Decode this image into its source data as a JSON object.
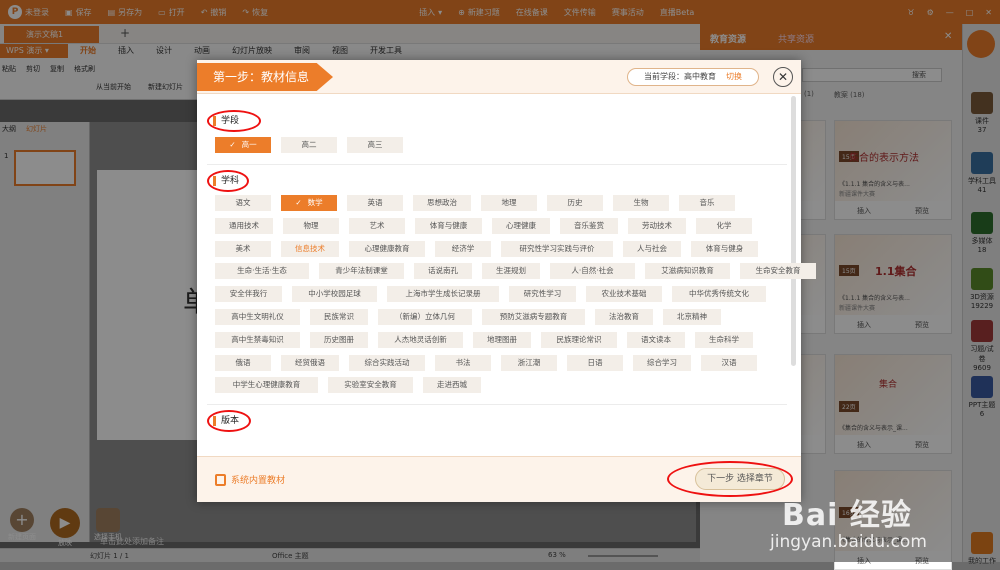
{
  "topbar": {
    "login": "未登录",
    "save": "保存",
    "save_as": "另存为",
    "open": "打开",
    "undo": "撤销",
    "redo": "恢复",
    "insert": "插入",
    "new_exercise": "新建习题",
    "online_class": "在线备课",
    "file_transfer": "文件传输",
    "contest": "赛事活动",
    "live": "直播Beta",
    "badge": "NEW"
  },
  "app": {
    "doc_tab": "演示文稿1",
    "product": "WPS 演示",
    "ribbon_tabs": [
      "开始",
      "插入",
      "设计",
      "动画",
      "幻灯片放映",
      "审阅",
      "视图",
      "开发工具"
    ],
    "ribbon_left": [
      "粘贴",
      "剪切",
      "复制",
      "格式刷"
    ],
    "from_current": "从当前开始",
    "new_slide": "新建幻灯片",
    "pane_tabs": [
      "大纲",
      "幻灯片"
    ],
    "slide_number": "1",
    "bottom_buttons": [
      "新建页面",
      "放映",
      "选择手机"
    ],
    "note_hint": "单击此处添加备注",
    "status_slide": "幻灯片 1 / 1",
    "status_theme": "Office 主题",
    "zoom": "63 %",
    "slide_char": "单"
  },
  "rightpanel": {
    "tabs": [
      "教育资源",
      "共享资源"
    ],
    "search_btn": "搜索",
    "counts": [
      "(1)",
      "教案 (18)"
    ],
    "thumbs": [
      {
        "badge": "15页",
        "title": "集合的表示方法",
        "line1": "《1.1.1 集合的含义与表...",
        "line2": "新疆课件大赛",
        "insert": "插入",
        "preview": "预览"
      },
      {
        "badge": "15页",
        "title": "1.1集合",
        "line1": "《1.1.1 集合的含义与表...",
        "line2": "新疆课件大赛",
        "insert": "插入",
        "preview": "预览"
      },
      {
        "badge": "22页",
        "title": "集合",
        "line1": "《集合的含义与表示_课...",
        "line2": "",
        "insert": "插入",
        "preview": "预览"
      },
      {
        "badge": "16页",
        "title": "",
        "line1": "《集合的含义与表示_课...",
        "line2": "",
        "insert": "插入",
        "preview": "预览"
      }
    ],
    "left_col_partial": [
      "插入",
      "插入",
      "插入",
      "插入"
    ]
  },
  "farstrip": {
    "items": [
      {
        "label": "课件",
        "count": "37",
        "color": "#7a5a3a"
      },
      {
        "label": "学科工具",
        "count": "41",
        "color": "#3a6fa0"
      },
      {
        "label": "多媒体",
        "count": "18",
        "color": "#2d6e2d"
      },
      {
        "label": "3D资源",
        "count": "19229",
        "color": "#5a8a2a"
      },
      {
        "label": "习题/试卷",
        "count": "9609",
        "color": "#a03a3a"
      },
      {
        "label": "PPT主题",
        "count": "6",
        "color": "#3a5aa0"
      },
      {
        "label": "我的工作",
        "count": "",
        "color": "#e07a20"
      }
    ]
  },
  "dialog": {
    "step_title": "第一步：教材信息",
    "current_school": "当前学段：高中教育",
    "switch": "切换",
    "close": "✕",
    "section_stage": "学段",
    "section_subject": "学科",
    "section_edition": "版本",
    "stages": [
      "高一",
      "高二",
      "高三"
    ],
    "subjects": [
      [
        "语文",
        "数学",
        "英语",
        "思想政治",
        "地理",
        "历史",
        "生物",
        "音乐"
      ],
      [
        "通用技术",
        "物理",
        "艺术",
        "体育与健康",
        "心理健康",
        "音乐鉴赏",
        "劳动技术",
        "化学"
      ],
      [
        "美术",
        "信息技术",
        "心理健康教育",
        "经济学",
        "研究性学习实践与评价",
        "人与社会",
        "体育与健身"
      ],
      [
        "生命·生活·生态",
        "青少年法制课堂",
        "话说南孔",
        "生涯规划",
        "人·自然·社会",
        "艾滋病知识教育",
        "生命安全教育"
      ],
      [
        "安全伴我行",
        "中小学校园足球",
        "上海市学生成长记录册",
        "研究性学习",
        "农业技术基础",
        "中华优秀传统文化"
      ],
      [
        "高中生文明礼仪",
        "民族常识",
        "（新编）立体几何",
        "预防艾滋病专题教育",
        "法治教育",
        "北京精神"
      ],
      [
        "高中生禁毒知识",
        "历史图册",
        "人杰地灵话创新",
        "地理图册",
        "民族理论常识",
        "语文读本",
        "生命科学"
      ],
      [
        "俄语",
        "经贸俄语",
        "综合实践活动",
        "书法",
        "浙江潮",
        "日语",
        "综合学习",
        "汉语"
      ],
      [
        "中学生心理健康教育",
        "实验室安全教育",
        "走进西城"
      ]
    ],
    "builtin": "系统内置教材",
    "next": "下一步 选择章节",
    "selected_stage": "高一",
    "selected_subject": "数学",
    "check": "✓"
  },
  "watermark": {
    "brand": "Bai 经验",
    "url": "jingyan.baidu.com"
  }
}
